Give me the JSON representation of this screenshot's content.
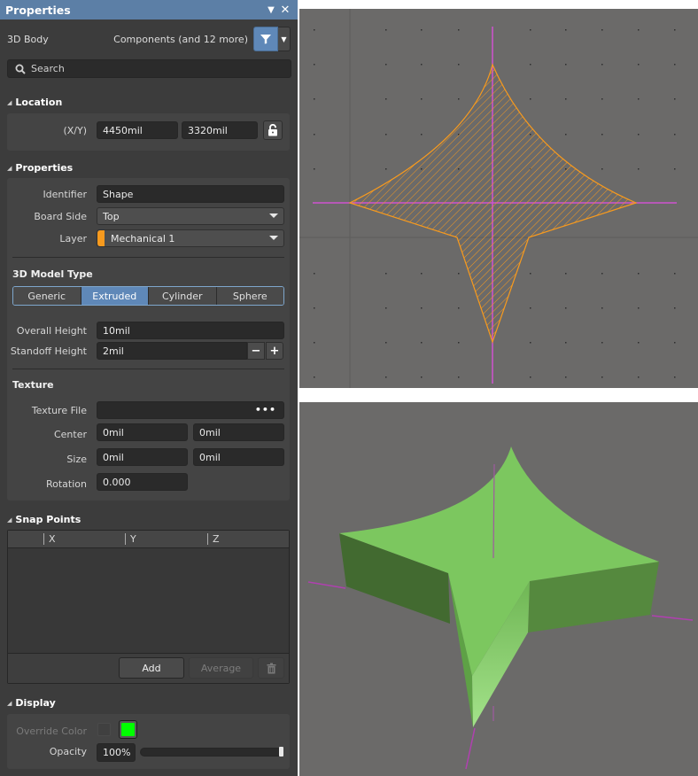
{
  "panel": {
    "title": "Properties",
    "menu_icon": "triangle-down-icon",
    "close_icon": "close-icon",
    "object_kind": "3D Body",
    "filter_summary": "Components (and 12 more)",
    "filter_icon": "funnel-icon",
    "search": {
      "placeholder": "Search",
      "value": ""
    }
  },
  "location": {
    "header": "Location",
    "xy_label": "(X/Y)",
    "x": "4450mil",
    "y": "3320mil",
    "lock_state": "unlocked"
  },
  "properties": {
    "header": "Properties",
    "identifier_label": "Identifier",
    "identifier": "Shape",
    "board_side_label": "Board Side",
    "board_side": "Top",
    "layer_label": "Layer",
    "layer": "Mechanical 1",
    "layer_color": "#f79a1e",
    "model_type_header": "3D Model Type",
    "model_types": [
      {
        "label": "Generic",
        "active": false
      },
      {
        "label": "Extruded",
        "active": true
      },
      {
        "label": "Cylinder",
        "active": false
      },
      {
        "label": "Sphere",
        "active": false
      }
    ],
    "overall_height_label": "Overall Height",
    "overall_height": "10mil",
    "standoff_height_label": "Standoff Height",
    "standoff_height": "2mil",
    "minus": "−",
    "plus": "+",
    "texture_header": "Texture",
    "texture_file_label": "Texture File",
    "texture_file": "",
    "texture_browse": "•••",
    "center_label": "Center",
    "center_x": "0mil",
    "center_y": "0mil",
    "size_label": "Size",
    "size_x": "0mil",
    "size_y": "0mil",
    "rotation_label": "Rotation",
    "rotation": "0.000"
  },
  "snap_points": {
    "header": "Snap Points",
    "columns": [
      "",
      "X",
      "Y",
      "Z"
    ],
    "rows": [],
    "add_label": "Add",
    "average_label": "Average",
    "delete_icon": "trash-icon"
  },
  "display": {
    "header": "Display",
    "override_color_label": "Override Color",
    "override_checked": false,
    "override_color": "#00ff00",
    "opacity_label": "Opacity",
    "opacity": "100%",
    "opacity_value": 1.0
  },
  "viewports": {
    "top_view": {
      "background": "#6b6a69",
      "shape_outline_color": "#f79a1e",
      "axis_color": "#d052d0",
      "hatch": "diagonal"
    },
    "view_3d": {
      "background": "#6b6a69",
      "body_color": "#7cc75f",
      "axis_color": "#b040b0"
    }
  }
}
